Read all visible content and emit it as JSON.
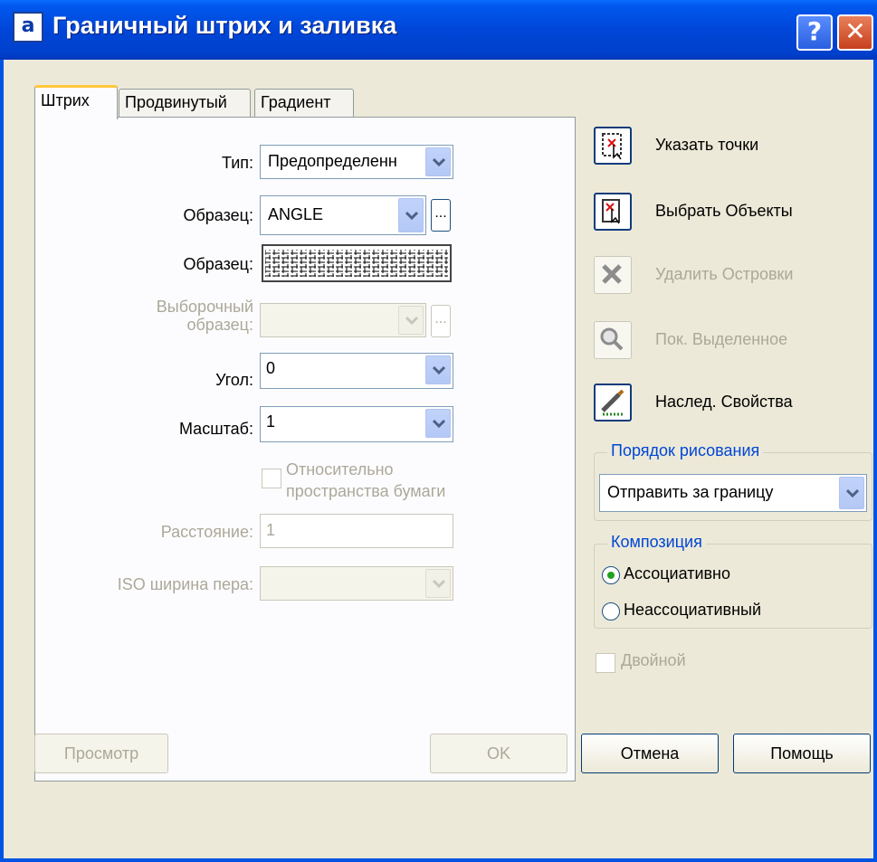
{
  "window": {
    "title": "Граничный штрих и заливка",
    "icon": "hatch-app-icon",
    "help": "?",
    "close": "✕"
  },
  "tabs": [
    {
      "label": "Штрих"
    },
    {
      "label": "Продвинутый"
    },
    {
      "label": "Градиент"
    }
  ],
  "hatch": {
    "type_label": "Тип:",
    "type_value": "Предопределенн",
    "pattern_label": "Образец:",
    "pattern_value": "ANGLE",
    "pattern_browse": "...",
    "swatch_label": "Образец:",
    "custom_label_1": "Выборочный",
    "custom_label_2": "образец:",
    "custom_browse": "...",
    "angle_label": "Угол:",
    "angle_value": "0",
    "scale_label": "Масштаб:",
    "scale_value": "1",
    "relative_label_1": "Относительно",
    "relative_label_2": "пространства бумаги",
    "spacing_label": "Расстояние:",
    "spacing_value": "1",
    "iso_label": "ISO ширина пера:"
  },
  "actions": [
    {
      "label": "Указать точки",
      "icon": "pick-points-icon"
    },
    {
      "label": "Выбрать Объекты",
      "icon": "select-objects-icon"
    },
    {
      "label": "Удалить Островки",
      "icon": "remove-islands-icon"
    },
    {
      "label": "Пок. Выделенное",
      "icon": "view-selection-icon"
    },
    {
      "label": "Наслед. Свойства",
      "icon": "inherit-properties-icon"
    }
  ],
  "draw_order": {
    "title": "Порядок рисования",
    "value": "Отправить за границу"
  },
  "composition": {
    "title": "Композиция",
    "associative": "Ассоциативно",
    "nonassociative": "Неассоциативный"
  },
  "double": {
    "label": "Двойной"
  },
  "buttons": {
    "preview": "Просмотр",
    "ok": "OK",
    "cancel": "Отмена",
    "help": "Помощь"
  }
}
